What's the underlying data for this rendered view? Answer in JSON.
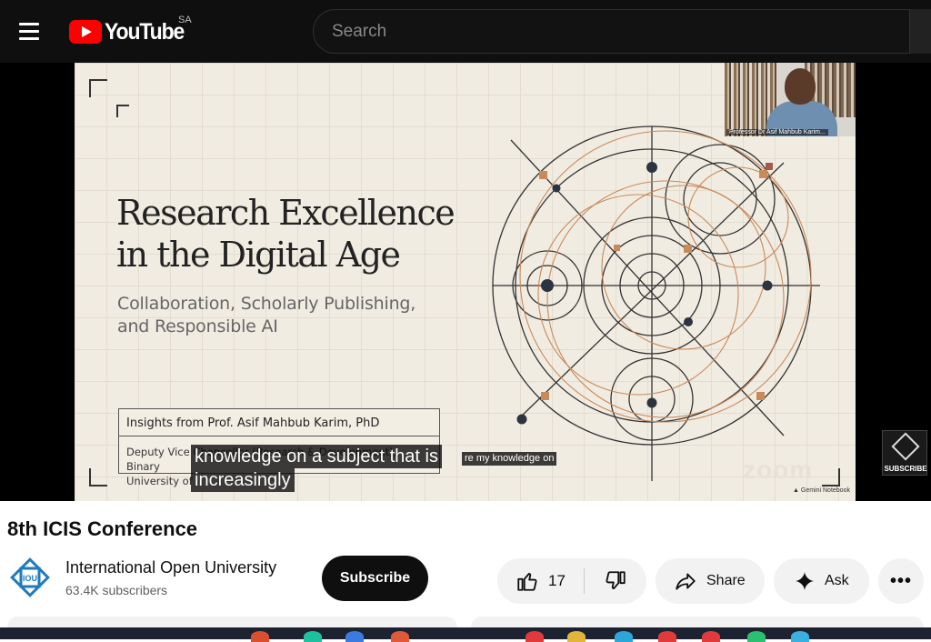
{
  "header": {
    "logo_text": "YouTube",
    "region": "SA",
    "search_placeholder": "Search"
  },
  "player": {
    "slide": {
      "title_line1": "Research Excellence",
      "title_line2": "in the Digital Age",
      "subtitle_line1": "Collaboration, Scholarly Publishing,",
      "subtitle_line2": "and Responsible AI",
      "box_line1": "Insights from Prof. Asif Mahbub Karim, PhD",
      "box_line2": "Deputy Vice Chancellor (Research & Development), Binary",
      "box_line3": "University of",
      "footer_credit": "Gemini Notebook",
      "zoom_watermark": "zoom"
    },
    "webcam": {
      "name": "Professor Dr Asif Mahbub Karim..."
    },
    "captions": {
      "line1": "knowledge on a subject that is",
      "line2": "increasingly",
      "small": "re my knowledge on"
    },
    "subscribe_watermark": "SUBSCRIBE"
  },
  "video": {
    "title": "8th ICIS Conference"
  },
  "channel": {
    "name": "International Open University",
    "subscribers": "63.4K subscribers",
    "avatar_text": "IOU",
    "subscribe_label": "Subscribe"
  },
  "actions": {
    "like_count": "17",
    "share_label": "Share",
    "ask_label": "Ask",
    "more_label": "•••"
  },
  "colors": {
    "brand_red": "#ff0000",
    "topbar_bg": "#0f0f0f",
    "slide_bg": "#f1ece2",
    "accent_copper": "#c98a5a",
    "iou_blue": "#1f7ac0"
  }
}
